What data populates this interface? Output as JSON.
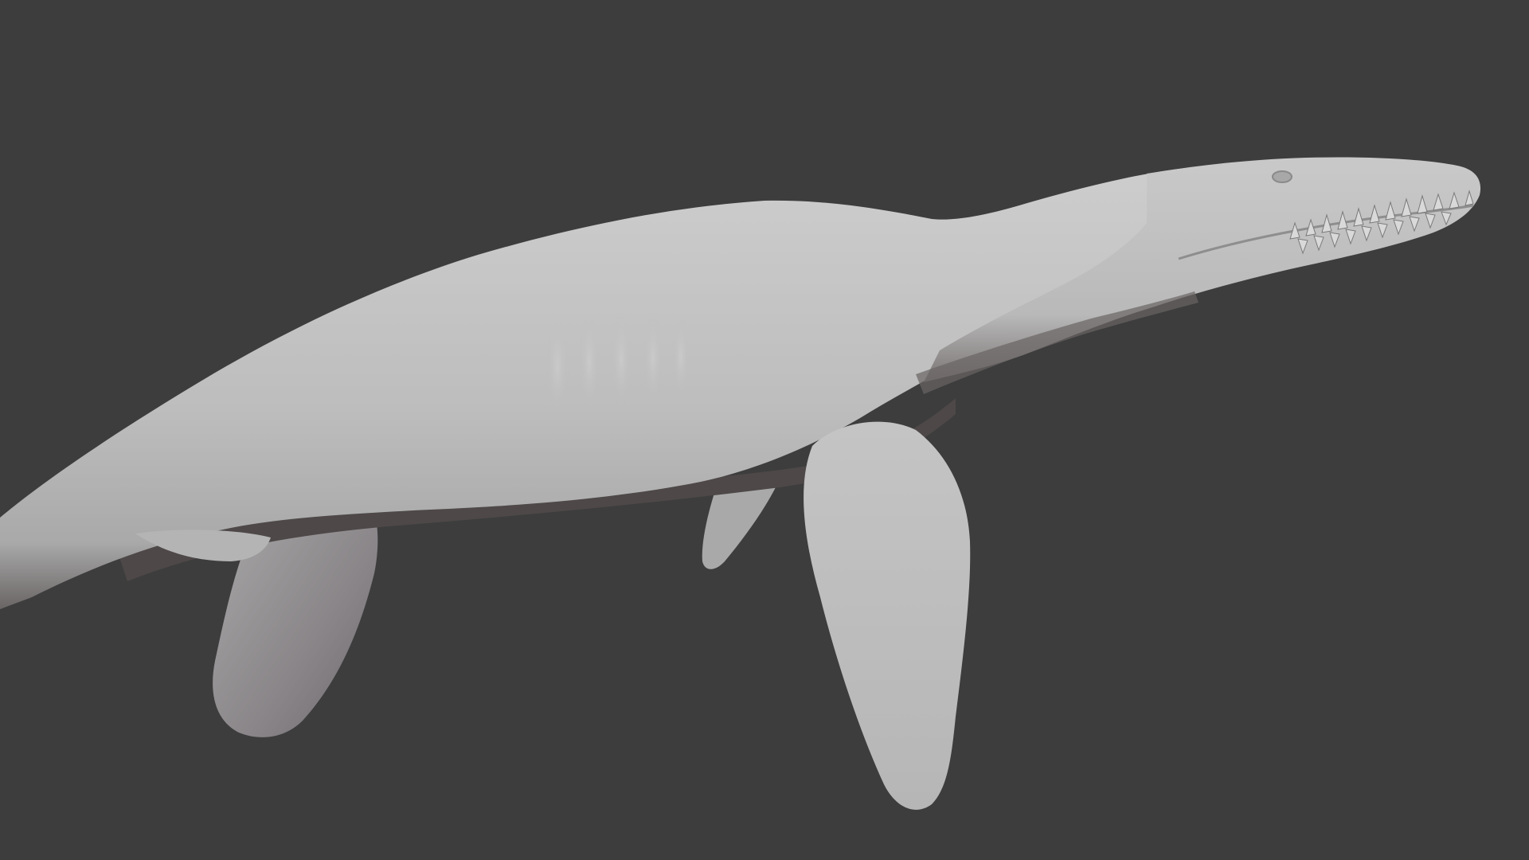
{
  "viewport": {
    "background_color": "#3d3d3d",
    "model_color": "#bcbcbc",
    "shadow_color": "#4a4646"
  },
  "model": {
    "parts": [
      "body",
      "neck",
      "head",
      "teeth",
      "front-flipper",
      "rear-flipper",
      "small-fin",
      "tail"
    ]
  }
}
